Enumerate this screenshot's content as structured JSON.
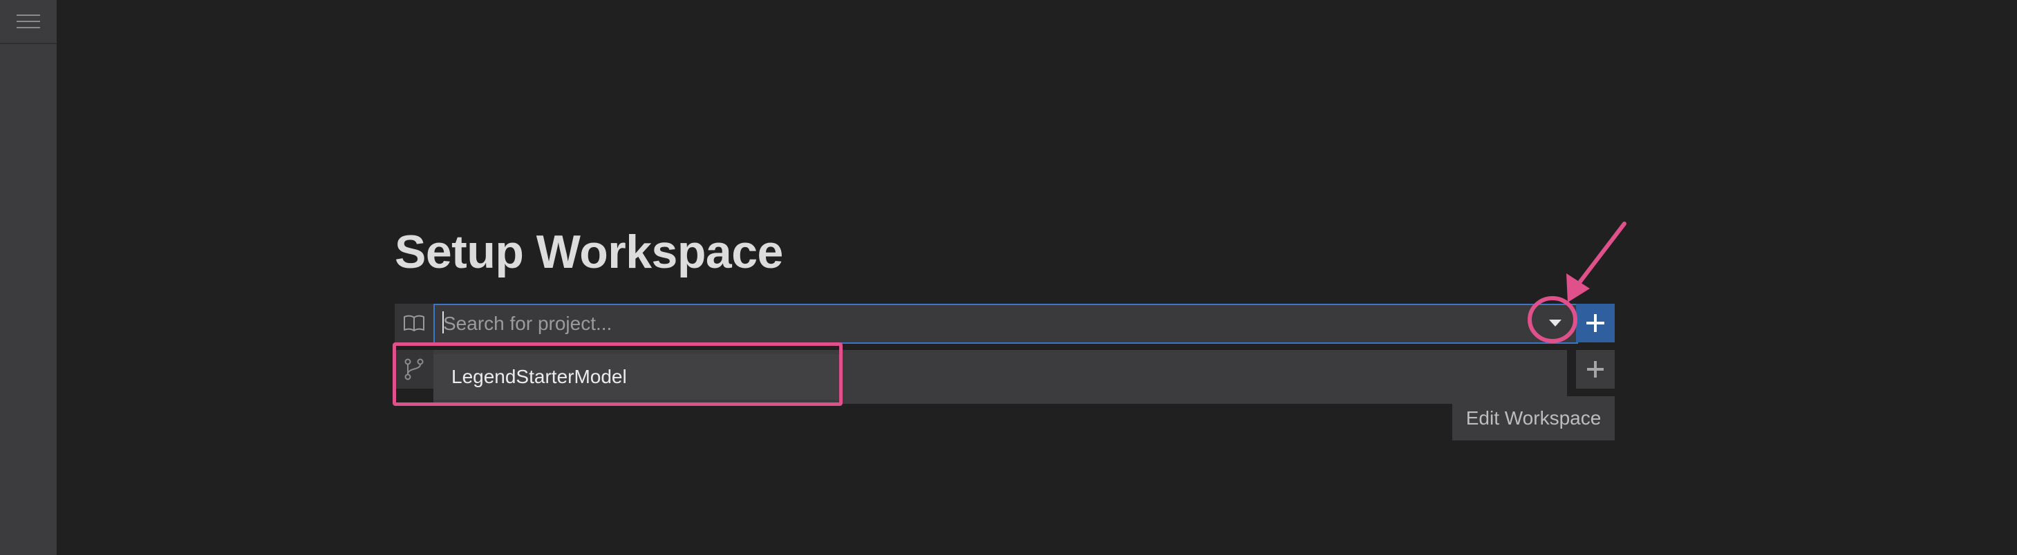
{
  "sidebar": {
    "menu_icon": "hamburger-menu-icon"
  },
  "page": {
    "title": "Setup Workspace"
  },
  "project_row": {
    "icon": "book-icon",
    "search_placeholder": "Search for project...",
    "search_value": "",
    "dropdown_icon": "caret-down-icon",
    "add_icon": "plus-icon"
  },
  "options": [
    {
      "label": "LegendStarterModel"
    }
  ],
  "branch_row": {
    "icon": "git-branch-icon",
    "add_icon": "plus-icon"
  },
  "actions": {
    "edit_workspace_label": "Edit Workspace"
  },
  "annotation": {
    "color": "#e0508a",
    "arrow_icon": "arrow-annotation",
    "circle_icon": "circle-annotation"
  },
  "colors": {
    "background": "#202021",
    "sidebar": "#3c3c3e",
    "accent": "#2f5f9f",
    "focus_border": "#3b76c9",
    "annotation": "#e0508a"
  }
}
